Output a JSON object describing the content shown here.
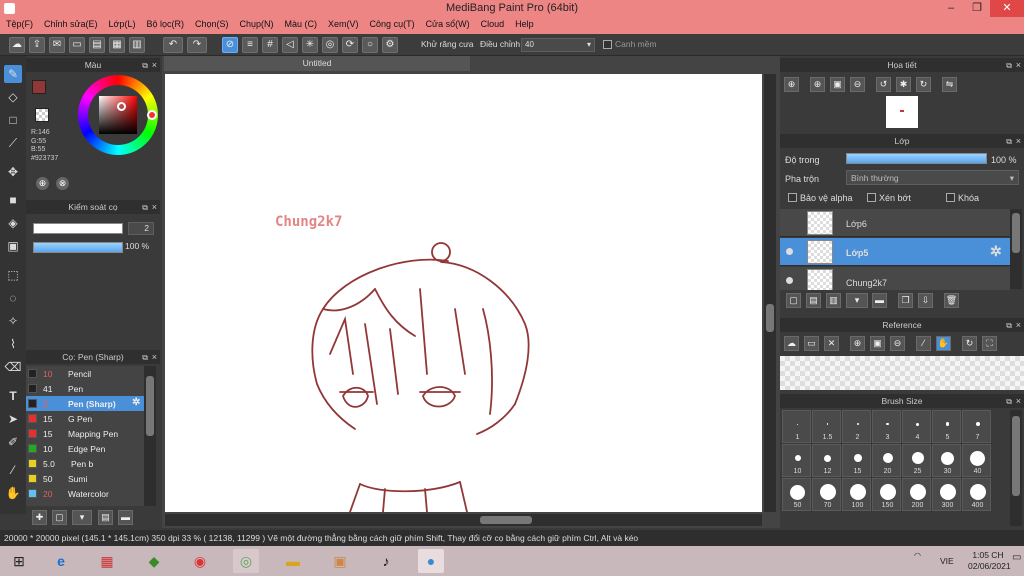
{
  "window": {
    "title": "MediBang Paint Pro (64bit)",
    "minimize": "–",
    "restore": "❐",
    "close": "✕"
  },
  "menu": [
    "Tệp(F)",
    "Chỉnh sửa(E)",
    "Lớp(L)",
    "Bộ lọc(R)",
    "Chọn(S)",
    "Chụp(N)",
    "Màu (C)",
    "Xem(V)",
    "Công cụ(T)",
    "Cửa sổ(W)",
    "Cloud",
    "Help"
  ],
  "toolbar": {
    "antialias_label": "Khử răng cưa",
    "adjust_label": "Điều chỉnh",
    "adjust_value": "40",
    "smooth_label": "Canh mềm",
    "antialias_checked": "✕"
  },
  "color_panel": {
    "title": "Màu",
    "r": "R:146",
    "g": "G:55",
    "b": "B:55",
    "hex": "#923737",
    "primary_color": "#923737"
  },
  "brush_control": {
    "title": "Kiểm soát cọ",
    "size": "2",
    "opacity": "100 %"
  },
  "brush_panel": {
    "title": "Cọ: Pen (Sharp)",
    "items": [
      {
        "size": "10",
        "name": "Pencil",
        "color": "#222222",
        "size_color": "#e06060"
      },
      {
        "size": "41",
        "name": "Pen",
        "color": "#222222",
        "size_color": "#eeeeee"
      },
      {
        "size": "2",
        "name": "Pen (Sharp)",
        "color": "#222222",
        "size_color": "#e06060"
      },
      {
        "size": "15",
        "name": "G Pen",
        "color": "#e53030",
        "size_color": "#eeeeee"
      },
      {
        "size": "15",
        "name": "Mapping Pen",
        "color": "#e53030",
        "size_color": "#eeeeee"
      },
      {
        "size": "10",
        "name": "Edge Pen",
        "color": "#22aa22",
        "size_color": "#eeeeee"
      },
      {
        "size": "5.0",
        "name": "Pen b",
        "color": "#e8d020",
        "size_color": "#eeeeee"
      },
      {
        "size": "50",
        "name": "Sumi",
        "color": "#e8d020",
        "size_color": "#eeeeee"
      },
      {
        "size": "20",
        "name": "Watercolor",
        "color": "#60c0f0",
        "size_color": "#e06060"
      }
    ]
  },
  "canvas": {
    "tab": "Untitled",
    "signature": "Chung2k7"
  },
  "navigator": {
    "title": "Họa tiết"
  },
  "layer_panel": {
    "title": "Lớp",
    "opacity_label": "Độ trong",
    "opacity_value": "100 %",
    "blend_label": "Pha trộn",
    "blend_value": "Bình thường",
    "protect_alpha": "Bảo vệ alpha",
    "clipping": "Xén bớt",
    "lock": "Khóa",
    "layers": [
      {
        "name": "Lớp6"
      },
      {
        "name": "Lớp5"
      },
      {
        "name": "Chung2k7"
      }
    ]
  },
  "reference_panel": {
    "title": "Reference"
  },
  "brush_size_panel": {
    "title": "Brush Size",
    "sizes": [
      "1",
      "1.5",
      "2",
      "3",
      "4",
      "5",
      "7",
      "10",
      "12",
      "15",
      "20",
      "25",
      "30",
      "40",
      "50",
      "70",
      "100",
      "150",
      "200",
      "300",
      "400"
    ]
  },
  "status": "20000 * 20000 pixel   (145.1 * 145.1cm)   350 dpi   33 %   ( 12138, 11299 )   Vẽ một đường thẳng bằng cách giữ phím Shift, Thay đổi cỡ cọ bằng cách giữ phím Ctrl, Alt và kéo",
  "taskbar": {
    "lang": "VIE",
    "time": "1:05 CH",
    "date": "02/06/2021"
  }
}
